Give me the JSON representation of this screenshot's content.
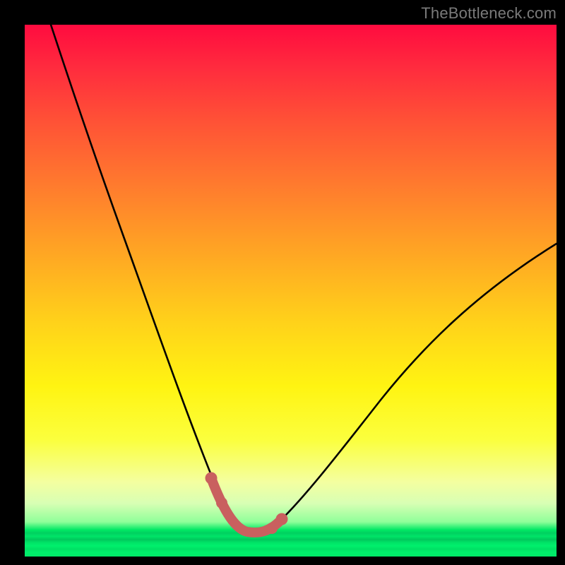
{
  "watermark": {
    "text": "TheBottleneck.com"
  },
  "colors": {
    "page_bg": "#000000",
    "curve_stroke": "#000000",
    "marker_stroke": "#c9605f",
    "gradient_stops": [
      "#ff0b3f",
      "#ff2b3e",
      "#ff5136",
      "#ff7a2e",
      "#ffa324",
      "#ffd21a",
      "#fff412",
      "#fbff3d",
      "#f4ffa0",
      "#d8ffb4",
      "#8fff9a",
      "#00e864",
      "#00d060",
      "#00e468",
      "#00c85c",
      "#00e467",
      "#00f06c",
      "#00e064",
      "#00ef6b",
      "#00e868"
    ]
  },
  "chart_data": {
    "type": "line",
    "title": "",
    "xlabel": "",
    "ylabel": "",
    "xlim": [
      0,
      100
    ],
    "ylim": [
      0,
      100
    ],
    "grid": false,
    "legend": false,
    "series": [
      {
        "name": "bottleneck-curve",
        "x": [
          5,
          8,
          11,
          14,
          17,
          20,
          23,
          26,
          29,
          32,
          34,
          36,
          38,
          40,
          42,
          44,
          46,
          48,
          51,
          55,
          59,
          63,
          67,
          71,
          75,
          80,
          85,
          90,
          95,
          100
        ],
        "y": [
          100,
          91,
          82,
          73,
          65,
          57,
          49,
          42,
          35,
          28,
          23,
          18,
          13,
          9,
          6,
          5,
          5,
          6,
          9,
          14,
          19,
          24,
          29,
          33,
          37,
          42,
          46,
          50,
          54,
          57
        ]
      },
      {
        "name": "optimal-range-marker",
        "x": [
          36,
          38,
          40,
          42,
          44,
          46,
          48
        ],
        "y": [
          13,
          8,
          6,
          5,
          5,
          6,
          9
        ]
      }
    ],
    "annotations": []
  }
}
